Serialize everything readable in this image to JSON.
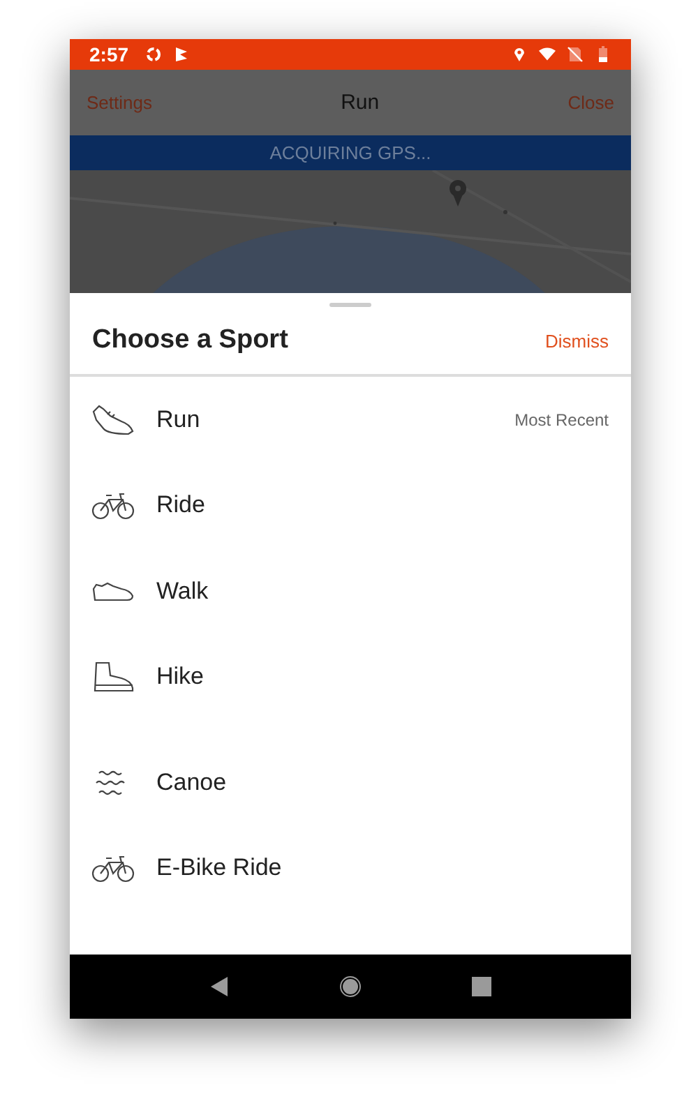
{
  "status_bar": {
    "time": "2:57"
  },
  "header": {
    "left": "Settings",
    "title": "Run",
    "right": "Close"
  },
  "banner": {
    "text": "ACQUIRING GPS..."
  },
  "sheet": {
    "title": "Choose a Sport",
    "action": "Dismiss",
    "sections": [
      {
        "items": [
          {
            "label": "Run",
            "kind": "run-shoe",
            "note": "Most Recent"
          },
          {
            "label": "Ride",
            "kind": "bike"
          },
          {
            "label": "Walk",
            "kind": "walk-shoe"
          },
          {
            "label": "Hike",
            "kind": "boot"
          }
        ]
      },
      {
        "items": [
          {
            "label": "Canoe",
            "kind": "waves"
          },
          {
            "label": "E-Bike Ride",
            "kind": "bike"
          }
        ]
      }
    ]
  }
}
